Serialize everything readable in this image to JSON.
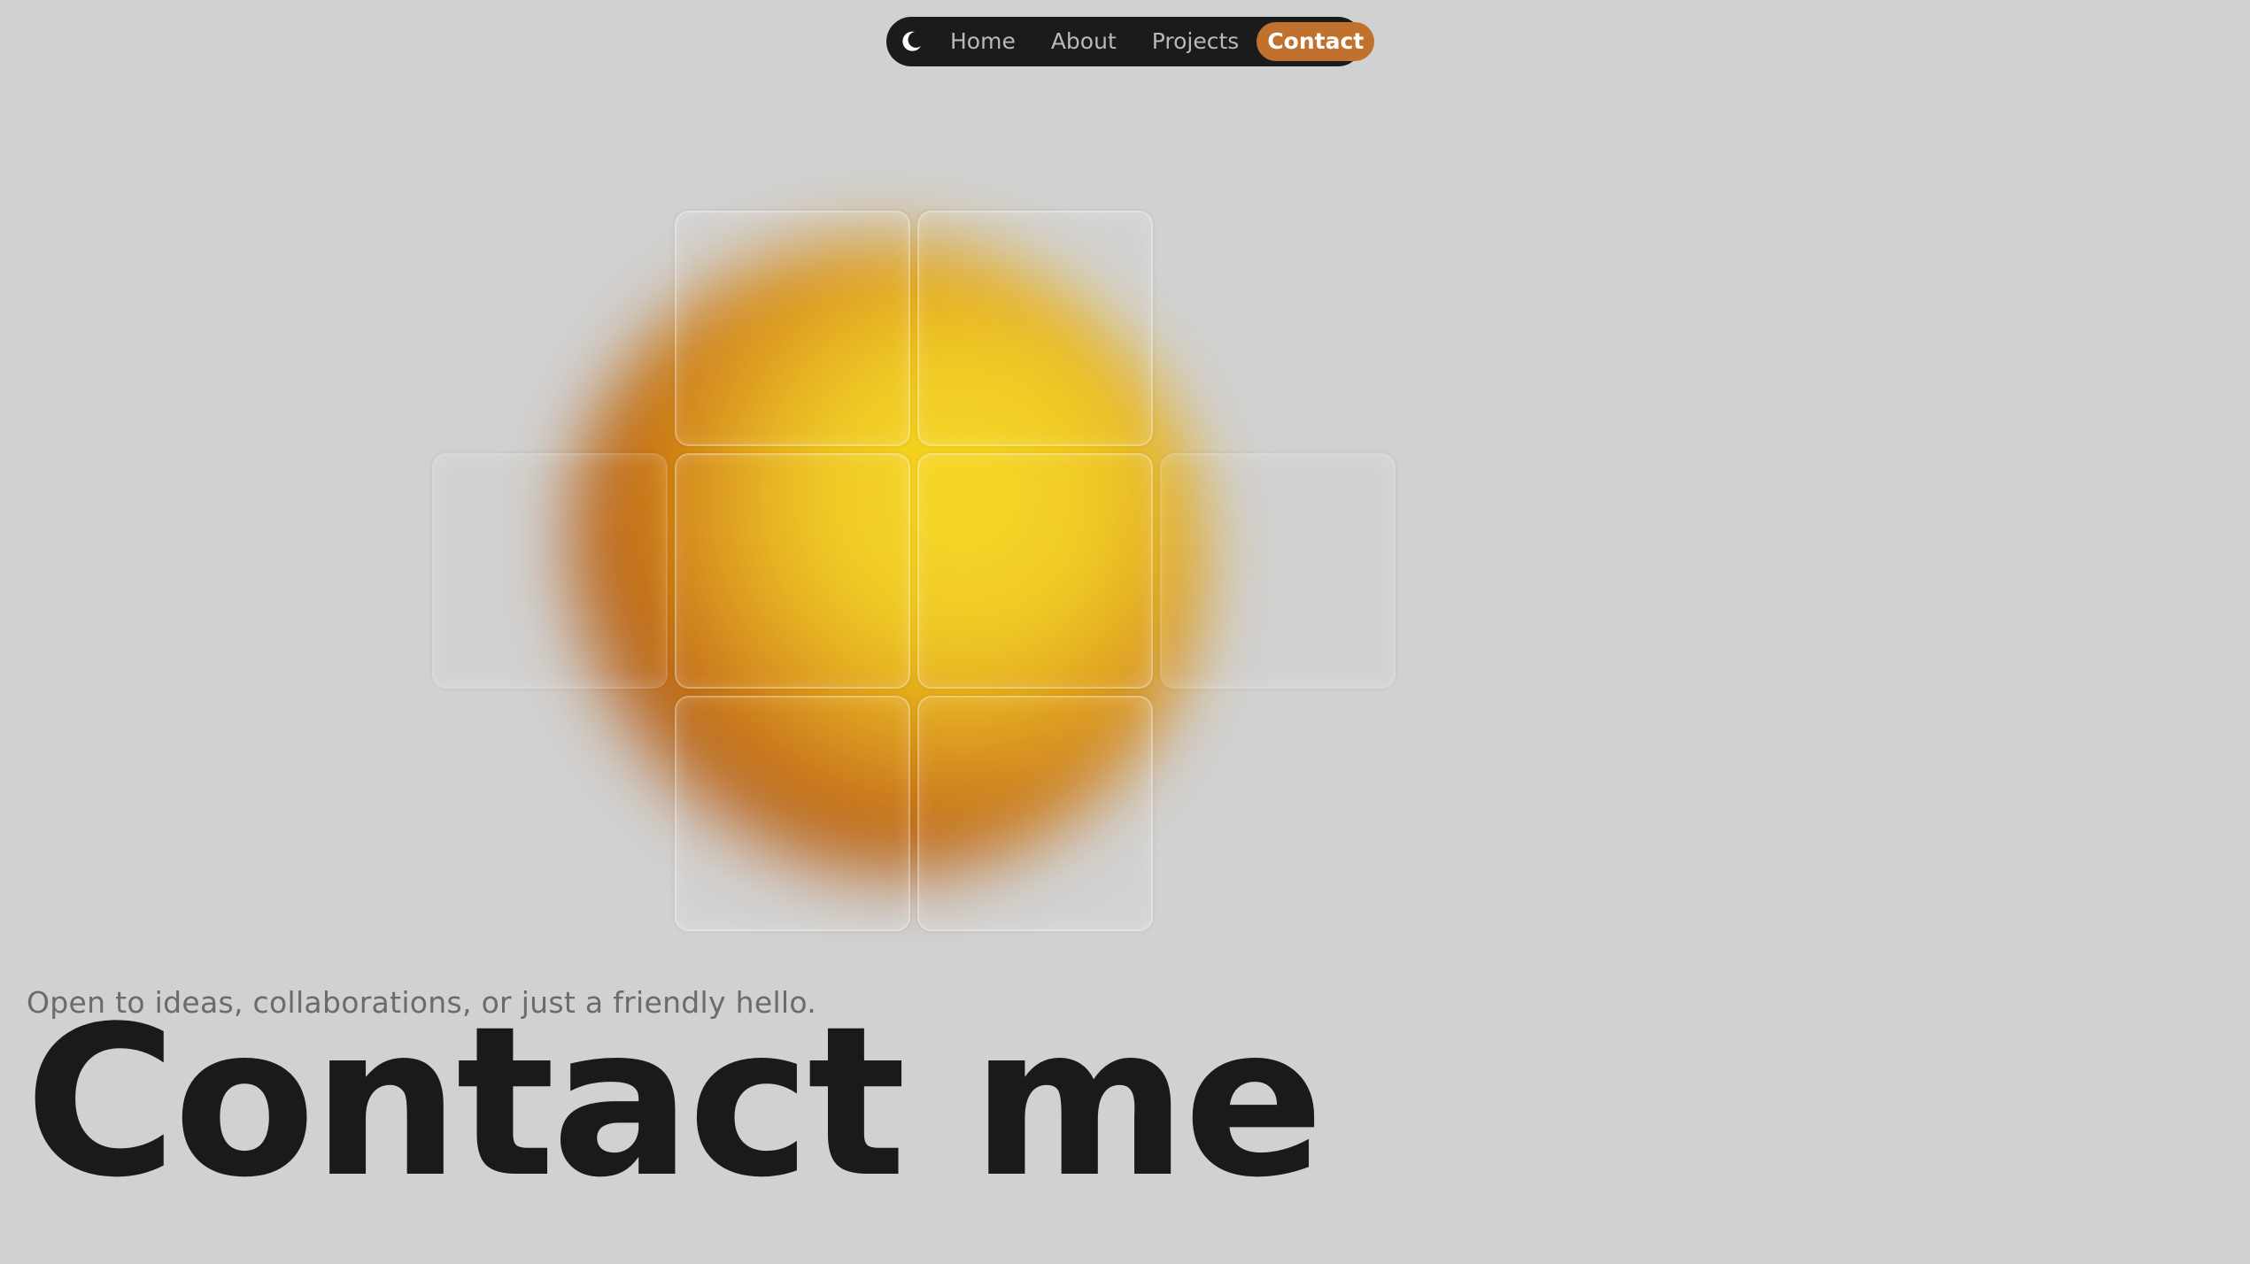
{
  "nav": {
    "theme_toggle_icon": "moon-icon",
    "items": [
      {
        "label": "Home"
      },
      {
        "label": "About"
      },
      {
        "label": "Projects"
      },
      {
        "label": "Contact",
        "active": true
      }
    ],
    "active_color": "#c0712e",
    "background_color": "#1b1b1b"
  },
  "artwork": {
    "description_icon": "glowing-tile-grid",
    "glow_colors": [
      "#f7da1f",
      "#d48616",
      "#b3590f"
    ]
  },
  "hero": {
    "tagline": "Open to ideas, collaborations, or just a friendly hello.",
    "title": "Contact me"
  },
  "colors": {
    "page_background": "#d1d1d1",
    "title_color": "#1a1a1a",
    "tagline_color": "#6b6b6b"
  }
}
